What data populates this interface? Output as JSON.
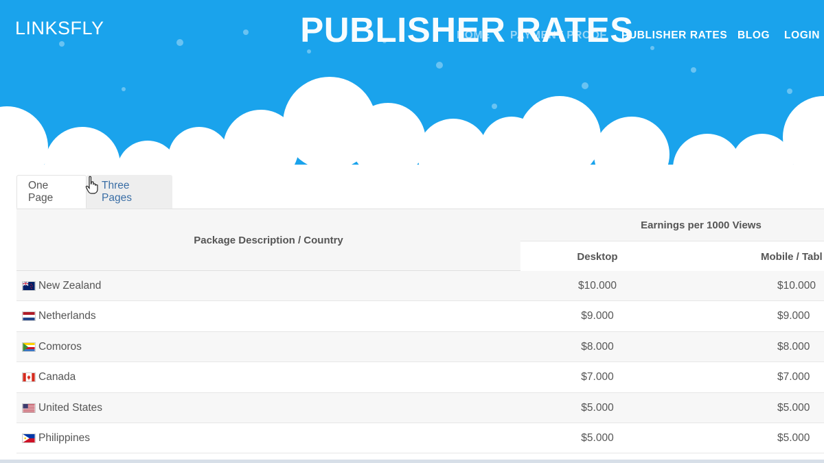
{
  "header": {
    "brand": "LINKSFLY",
    "title": "PUBLISHER RATES",
    "nav": [
      "HOME",
      "PAYMENT PROOF",
      "PUBLISHER RATES",
      "BLOG",
      "LOGIN"
    ],
    "sky_color": "#1aa3ec"
  },
  "tabs": [
    {
      "label": "One Page",
      "active": true
    },
    {
      "label": "Three Pages",
      "active": false
    }
  ],
  "table": {
    "col_description": "Package Description / Country",
    "col_earnings": "Earnings per 1000 Views",
    "col_desktop": "Desktop",
    "col_mobile": "Mobile / Tabl",
    "rows": [
      {
        "country": "New Zealand",
        "flag": "nz-flag-icon",
        "desktop": "$10.000",
        "mobile": "$10.000"
      },
      {
        "country": "Netherlands",
        "flag": "nl-flag-icon",
        "desktop": "$9.000",
        "mobile": "$9.000"
      },
      {
        "country": "Comoros",
        "flag": "km-flag-icon",
        "desktop": "$8.000",
        "mobile": "$8.000"
      },
      {
        "country": "Canada",
        "flag": "ca-flag-icon",
        "desktop": "$7.000",
        "mobile": "$7.000"
      },
      {
        "country": "United States",
        "flag": "us-flag-icon",
        "desktop": "$5.000",
        "mobile": "$5.000"
      },
      {
        "country": "Philippines",
        "flag": "ph-flag-icon",
        "desktop": "$5.000",
        "mobile": "$5.000"
      }
    ]
  }
}
